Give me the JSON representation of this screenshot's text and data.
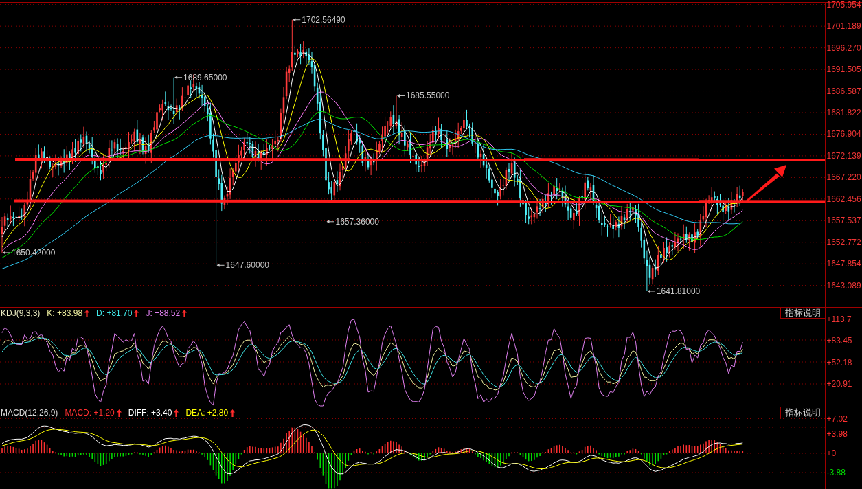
{
  "price_panel": {
    "axis_labels": [
      "1705.954",
      "1701.189",
      "1696.270",
      "1691.505",
      "1686.587",
      "1681.822",
      "1676.904",
      "1672.139",
      "1667.220",
      "1662.456",
      "1657.537",
      "1652.772",
      "1647.854",
      "1643.089"
    ],
    "price_marks": [
      "1702.56490",
      "1689.65000",
      "1685.55000",
      "1657.36000",
      "1650.42000",
      "1647.60000",
      "1641.81000"
    ]
  },
  "kdj_panel": {
    "title": "KDJ(9,3,3)",
    "legend": [
      {
        "text": "K: +83.98",
        "color": "#f0f0a0",
        "rising": true
      },
      {
        "text": "D: +81.70",
        "color": "#40e8e8",
        "rising": true
      },
      {
        "text": "J: +88.52",
        "color": "#e080f0",
        "rising": true
      }
    ],
    "button": "指标说明",
    "axis_labels": [
      "+113.7",
      "+83.45",
      "+52.18",
      "+20.91"
    ]
  },
  "macd_panel": {
    "title": "MACD(12,26,9)",
    "legend": [
      {
        "text": "MACD: +1.20",
        "color": "#ff3030",
        "rising": true
      },
      {
        "text": "DIFF: +3.40",
        "color": "#ffffff",
        "rising": true
      },
      {
        "text": "DEA: +2.80",
        "color": "#ffff00",
        "rising": true
      }
    ],
    "button": "指标说明",
    "axis_labels": [
      {
        "text": "+7.02",
        "color": "#ff3030"
      },
      {
        "text": "+3.98",
        "color": "#ff3030"
      },
      {
        "text": "+0",
        "color": "#ff3030"
      },
      {
        "text": "-3.88",
        "color": "#00e000"
      }
    ]
  }
}
